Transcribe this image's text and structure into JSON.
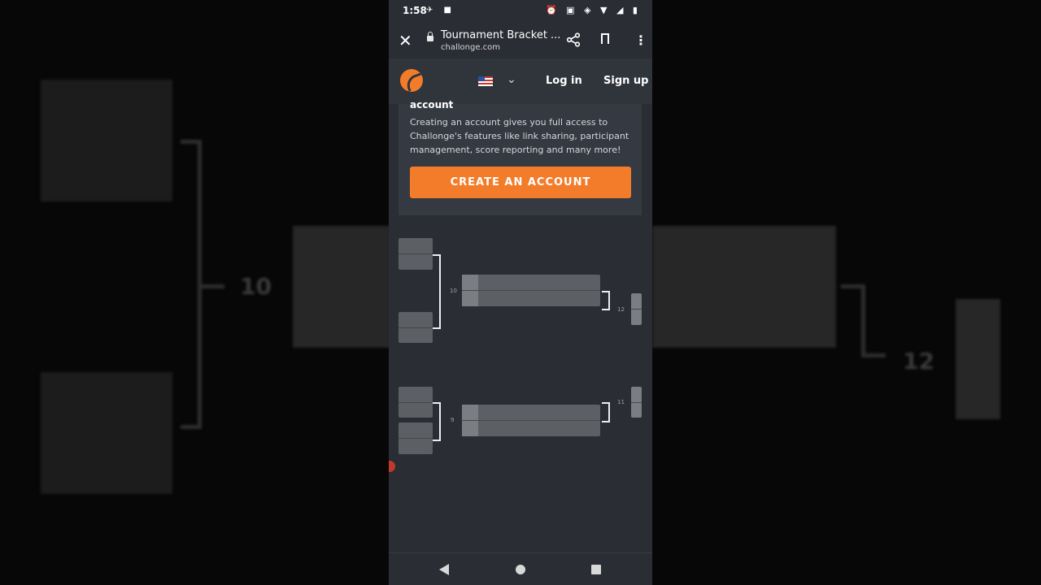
{
  "statusbar": {
    "time": "1:58",
    "left_icons": "✈ ■",
    "right_icons": "⏰ ▣ ◈ ▼ ◢ ▮"
  },
  "browser": {
    "close_label": "✕",
    "title": "Tournament Bracket ...",
    "domain": "challonge.com",
    "share_label": "⋖",
    "menu_label": "⋮"
  },
  "site_nav": {
    "chevron": "⌄",
    "login": "Log in",
    "signup": "Sign up"
  },
  "promo": {
    "heading": "account",
    "body": "Creating an account gives you full access to Challonge's features like link sharing, participant management, score reporting and many more!",
    "cta": "CREATE AN ACCOUNT"
  },
  "bracket": {
    "labels": [
      "10",
      "12",
      "9",
      "11"
    ]
  },
  "background": {
    "labels": [
      "10",
      "12"
    ]
  },
  "colors": {
    "accent": "#f37c2a",
    "page_bg": "#2a2d33",
    "nav_bg": "#30343b"
  }
}
